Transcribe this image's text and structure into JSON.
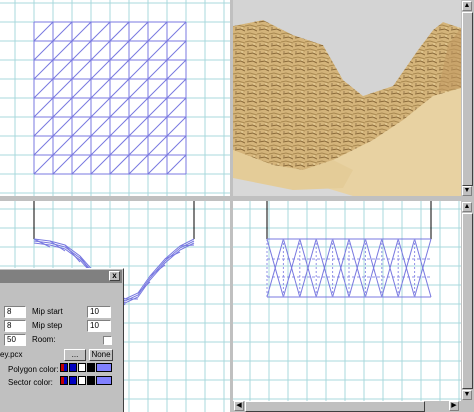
{
  "colors": {
    "grid": "#a8d8dc",
    "mesh": "#7878e0",
    "mesh_dashed": "#9090e8",
    "wall": "#000000",
    "floor": "#e8d4a8",
    "sky": "#d0d0d0"
  },
  "panel": {
    "close_label": "x",
    "rows": [
      {
        "value": "8",
        "label": "Mip start",
        "value2": "10"
      },
      {
        "value": "8",
        "label": "Mip step",
        "value2": "10"
      },
      {
        "value": "50",
        "label": "Room:"
      }
    ],
    "texture_file": "ey.pcx",
    "browse_label": "...",
    "none_label": "None",
    "polygon_color_label": "Polygon color:",
    "sector_color_label": "Sector color:"
  }
}
